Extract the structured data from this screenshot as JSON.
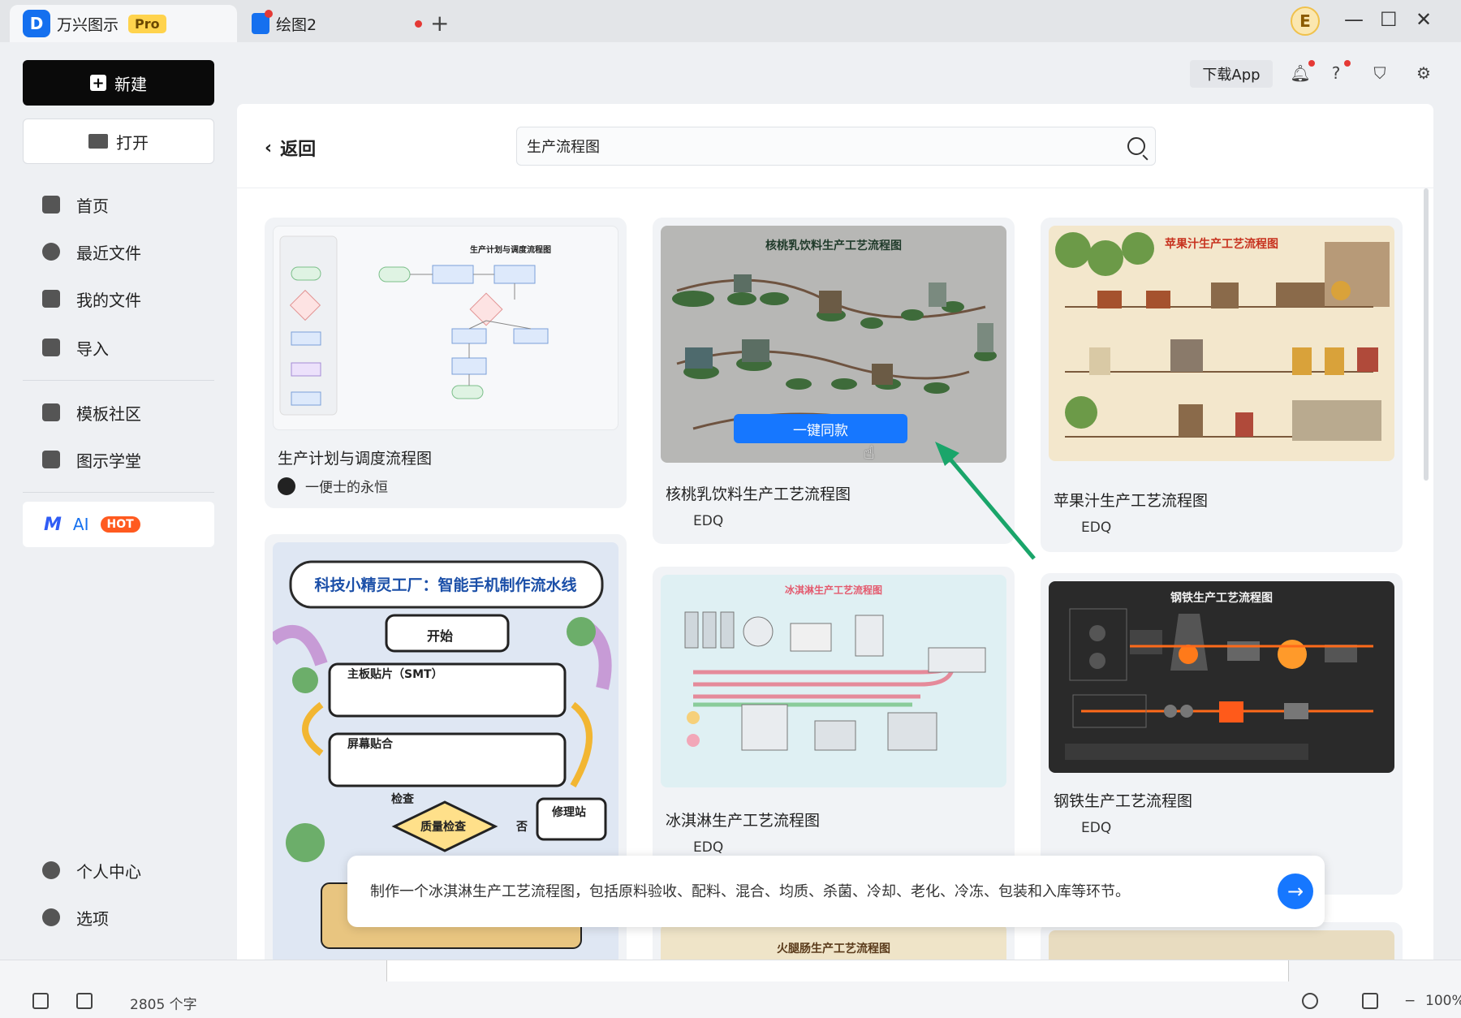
{
  "titlebar": {
    "app_name": "万兴图示",
    "pro_badge": "Pro",
    "doc_tab": "绘图2",
    "new_tab": "+",
    "avatar_letter": "E",
    "minimize": "—",
    "maximize": "☐",
    "close": "✕"
  },
  "sidebar": {
    "new_label": "新建",
    "open_label": "打开",
    "nav": [
      "首页",
      "最近文件",
      "我的文件",
      "导入",
      "模板社区",
      "图示学堂"
    ],
    "ai_label": "AI",
    "hot_badge": "HOT",
    "personal_center": "个人中心",
    "options": "选项"
  },
  "toolbar": {
    "download_app": "下载App"
  },
  "main": {
    "back_label": "返回",
    "search_value": "生产流程图",
    "clone_button": "一键同款",
    "cards": [
      {
        "title": "生产计划与调度流程图",
        "author": "一便士的永恒",
        "thumb_title": "生产计划与调度流程图"
      },
      {
        "title": "核桃乳饮料生产工艺流程图",
        "author": "EDQ",
        "thumb_title": "核桃乳饮料生产工艺流程图"
      },
      {
        "title": "苹果汁生产工艺流程图",
        "author": "EDQ",
        "thumb_title": "苹果汁生产工艺流程图"
      },
      {
        "title": "冰淇淋生产工艺流程图",
        "author": "EDQ",
        "thumb_title": "冰淇淋生产工艺流程图"
      },
      {
        "title": "钢铁生产工艺流程图",
        "author": "EDQ",
        "thumb_title": "钢铁生产工艺流程图"
      },
      {
        "thumb_title": "科技小精灵工厂：智能手机制作流水线",
        "step_start": "开始",
        "step_smt": "主板贴片（SMT）",
        "step_screen": "屏幕贴合",
        "step_check": "检查",
        "step_quality": "质量检查",
        "step_no": "否",
        "step_repair": "修理站"
      },
      {
        "thumb_title": "火腿肠生产工艺流程图"
      }
    ]
  },
  "prompt": {
    "text": "制作一个冰淇淋生产工艺流程图，包括原料验收、配料、混合、均质、杀菌、冷却、老化、冷冻、包装和入库等环节。",
    "send_icon": "→"
  },
  "statusbar": {
    "word_count": "2805 个字",
    "zoom": "100%"
  },
  "colors": {
    "accent": "#1677ff",
    "hot": "#ff5a1f",
    "pro": "#ffd34d",
    "arrow": "#1aa56a"
  }
}
